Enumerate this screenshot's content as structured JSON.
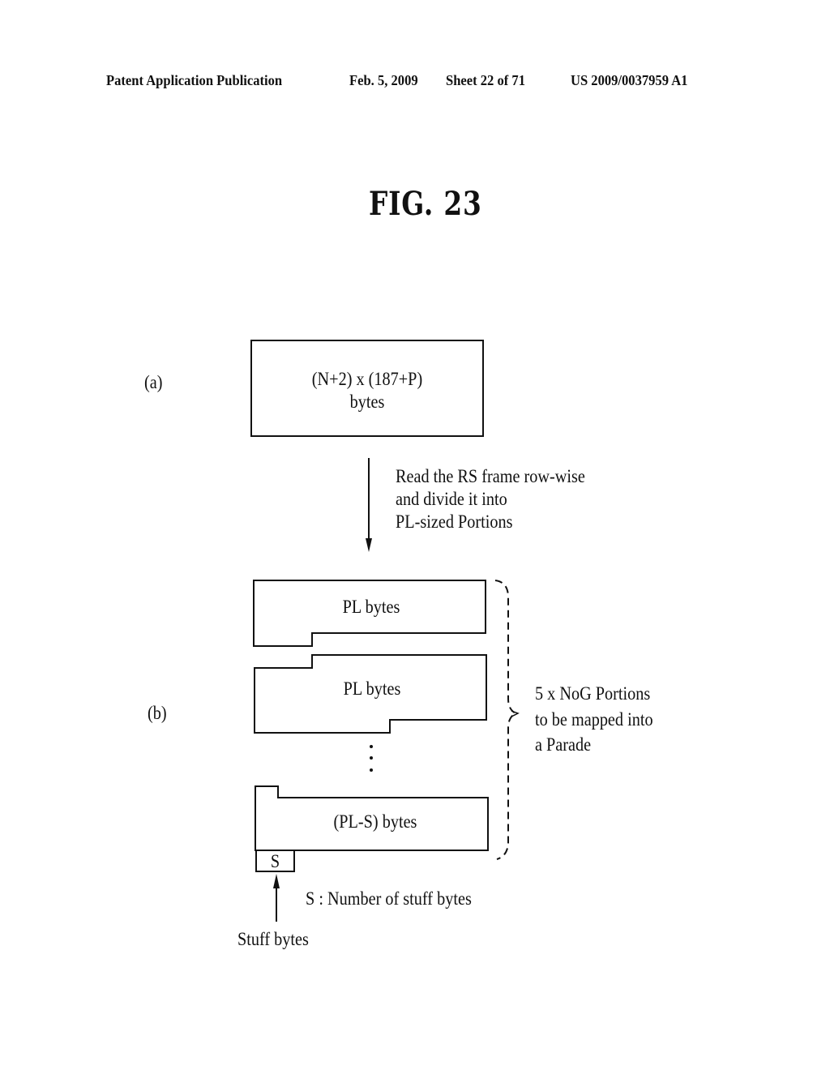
{
  "header": {
    "publication": "Patent Application Publication",
    "date": "Feb. 5, 2009",
    "sheet": "Sheet 22 of 71",
    "number": "US 2009/0037959 A1"
  },
  "figure": {
    "title": "FIG. 23",
    "part_a": {
      "label": "(a)",
      "box_line1": "(N+2)  x (187+P)",
      "box_line2": "bytes"
    },
    "transition": {
      "line1": "Read the RS frame row-wise",
      "line2": "and divide it into",
      "line3": "PL-sized Portions"
    },
    "part_b": {
      "label": "(b)",
      "portions": [
        {
          "label": "PL bytes"
        },
        {
          "label": "PL bytes"
        },
        {
          "label": "(PL-S) bytes"
        }
      ],
      "ellipsis": "⋮",
      "stuff_box_label": "S",
      "brace_text": {
        "line1": "5 x NoG Portions",
        "line2": "to be mapped into",
        "line3": "a Parade"
      },
      "legend": "S : Number of stuff bytes",
      "stuff_bytes_label": "Stuff bytes"
    }
  }
}
